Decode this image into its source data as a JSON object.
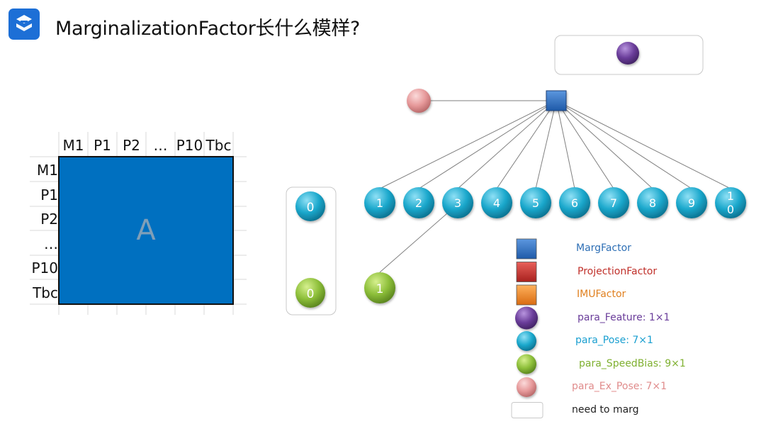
{
  "header": {
    "title": "MarginalizationFactor长什么模样?"
  },
  "matrix": {
    "column_labels": [
      "M1",
      "P1",
      "P2",
      "…",
      "P10",
      "Tbc"
    ],
    "row_labels": [
      "M1",
      "P1",
      "P2",
      "…",
      "P10",
      "Tbc"
    ],
    "block_label": "A"
  },
  "graph": {
    "pose_nodes": [
      "1",
      "2",
      "3",
      "4",
      "5",
      "6",
      "7",
      "8",
      "9",
      "1\n0"
    ],
    "marg_pose_label": "0",
    "marg_speedbias_label": "0",
    "speedbias_node_label": "1"
  },
  "legend": [
    {
      "shape": "square",
      "color": "#2e6fc0",
      "label": "MargFactor",
      "text_color": "#2e6fb5"
    },
    {
      "shape": "square",
      "color": "#c9302c",
      "label": "ProjectionFactor",
      "text_color": "#c0302a"
    },
    {
      "shape": "square",
      "color": "#f08a24",
      "label": "IMUFactor",
      "text_color": "#e0801f"
    },
    {
      "shape": "circle",
      "color": "#6a3d9a",
      "label": "para_Feature: 1×1",
      "text_color": "#6a3d9a"
    },
    {
      "shape": "circle",
      "color": "#1aa5c8",
      "label": "para_Pose: 7×1",
      "text_color": "#1a9fd0"
    },
    {
      "shape": "circle",
      "color": "#8dbf3a",
      "label": "para_SpeedBias: 9×1",
      "text_color": "#7fb030"
    },
    {
      "shape": "circle",
      "color": "#e6999a",
      "label": "para_Ex_Pose: 7×1",
      "text_color": "#e08c8c"
    },
    {
      "shape": "box",
      "color": "#ffffff",
      "label": "need to marg",
      "text_color": "#222222"
    }
  ],
  "colors": {
    "marg_factor": "#2e6fc0",
    "pose": "#1aa5c8",
    "speedbias": "#8dbf3a",
    "feature": "#6a3d9a",
    "ex_pose": "#e6999a",
    "matrix_fill": "#0070c0"
  },
  "icons": {
    "logo": "s-logo-icon"
  }
}
